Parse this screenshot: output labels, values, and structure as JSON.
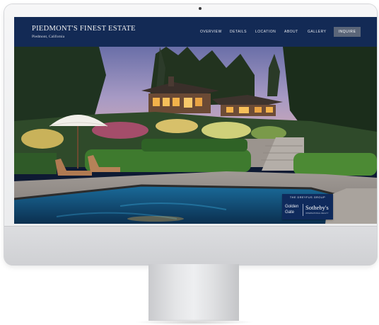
{
  "site": {
    "brand": {
      "title": "PIEDMONT'S FINEST ESTATE",
      "subtitle": "Piedmont, California"
    },
    "nav": {
      "items": [
        {
          "label": "OVERVIEW"
        },
        {
          "label": "DETAILS"
        },
        {
          "label": "LOCATION"
        },
        {
          "label": "ABOUT"
        },
        {
          "label": "GALLERY"
        }
      ],
      "cta_label": "INQUIRE"
    },
    "badge": {
      "group": "THE DREYFUS GROUP",
      "brokerage_line1": "Golden",
      "brokerage_line2": "Gate",
      "brand": "Sotheby's",
      "brand_sub": "INTERNATIONAL REALTY"
    }
  },
  "colors": {
    "header_bg": "#132a55",
    "cta_bg": "#5b6679",
    "badge_bg": "#0f2a5c",
    "device_frame": "#e9eaec"
  }
}
